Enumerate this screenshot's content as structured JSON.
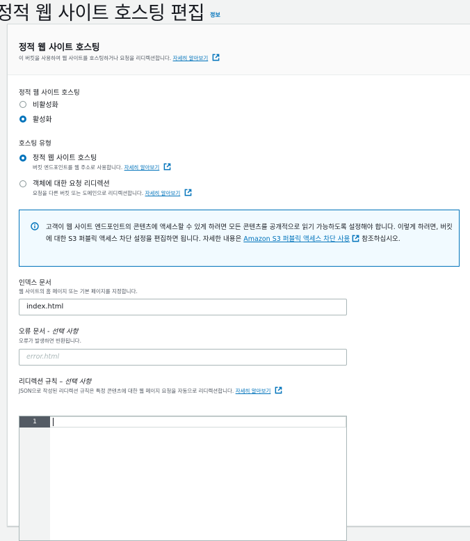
{
  "page": {
    "title": "정적 웹 사이트 호스팅 편집",
    "info": "정보"
  },
  "panel": {
    "title": "정적 웹 사이트 호스팅",
    "description": "이 버킷을 사용하여 웹 사이트를 호스팅하거나 요청을 리디렉션합니다.",
    "learn_more": "자세히 알아보기"
  },
  "hosting": {
    "label": "정적 웹 사이트 호스팅",
    "options": [
      {
        "label": "비활성화",
        "selected": false
      },
      {
        "label": "활성화",
        "selected": true
      }
    ]
  },
  "hosting_type": {
    "label": "호스팅 유형",
    "options": [
      {
        "label": "정적 웹 사이트 호스팅",
        "description": "버킷 엔드포인트를 웹 주소로 사용합니다.",
        "learn_more": "자세히 알아보기",
        "selected": true
      },
      {
        "label": "객체에 대한 요청 리디렉션",
        "description": "요청을 다른 버킷 또는 도메인으로 리디렉션합니다.",
        "learn_more": "자세히 알아보기",
        "selected": false
      }
    ]
  },
  "alert": {
    "text": "고객이 웹 사이트 엔드포인트의 콘텐츠에 액세스할 수 있게 하려면 모든 콘텐츠를 공개적으로 읽기 가능하도록 설정해야 합니다. 이렇게 하려면, 버킷에 대한 S3 퍼블릭 액세스 차단 설정을 편집하면 됩니다. 자세한 내용은 ",
    "link": "Amazon S3 퍼블릭 액세스 차단 사용",
    "suffix": " 참조하십시오."
  },
  "index_document": {
    "label": "인덱스 문서",
    "description": "웹 사이트의 홈 페이지 또는 기본 페이지를 지정합니다.",
    "value": "index.html"
  },
  "error_document": {
    "label": "오류 문서 - ",
    "optional": "선택 사항",
    "description": "오류가 발생하면 반환됩니다.",
    "placeholder": "error.html"
  },
  "redirection_rules": {
    "label": "리디렉션 규칙 – ",
    "optional": "선택 사항",
    "description": "JSON으로 작성된 리디렉션 규칙은 특정 콘텐츠에 대한 웹 페이지 요청을 자동으로 리디렉션합니다.",
    "learn_more": "자세히 알아보기",
    "line_number": "1"
  },
  "colors": {
    "link": "#0073bb",
    "alert_bg": "#f1faff",
    "radio_selected": "#0073bb"
  },
  "icons": [
    "external-link-icon",
    "info-circle-icon"
  ]
}
